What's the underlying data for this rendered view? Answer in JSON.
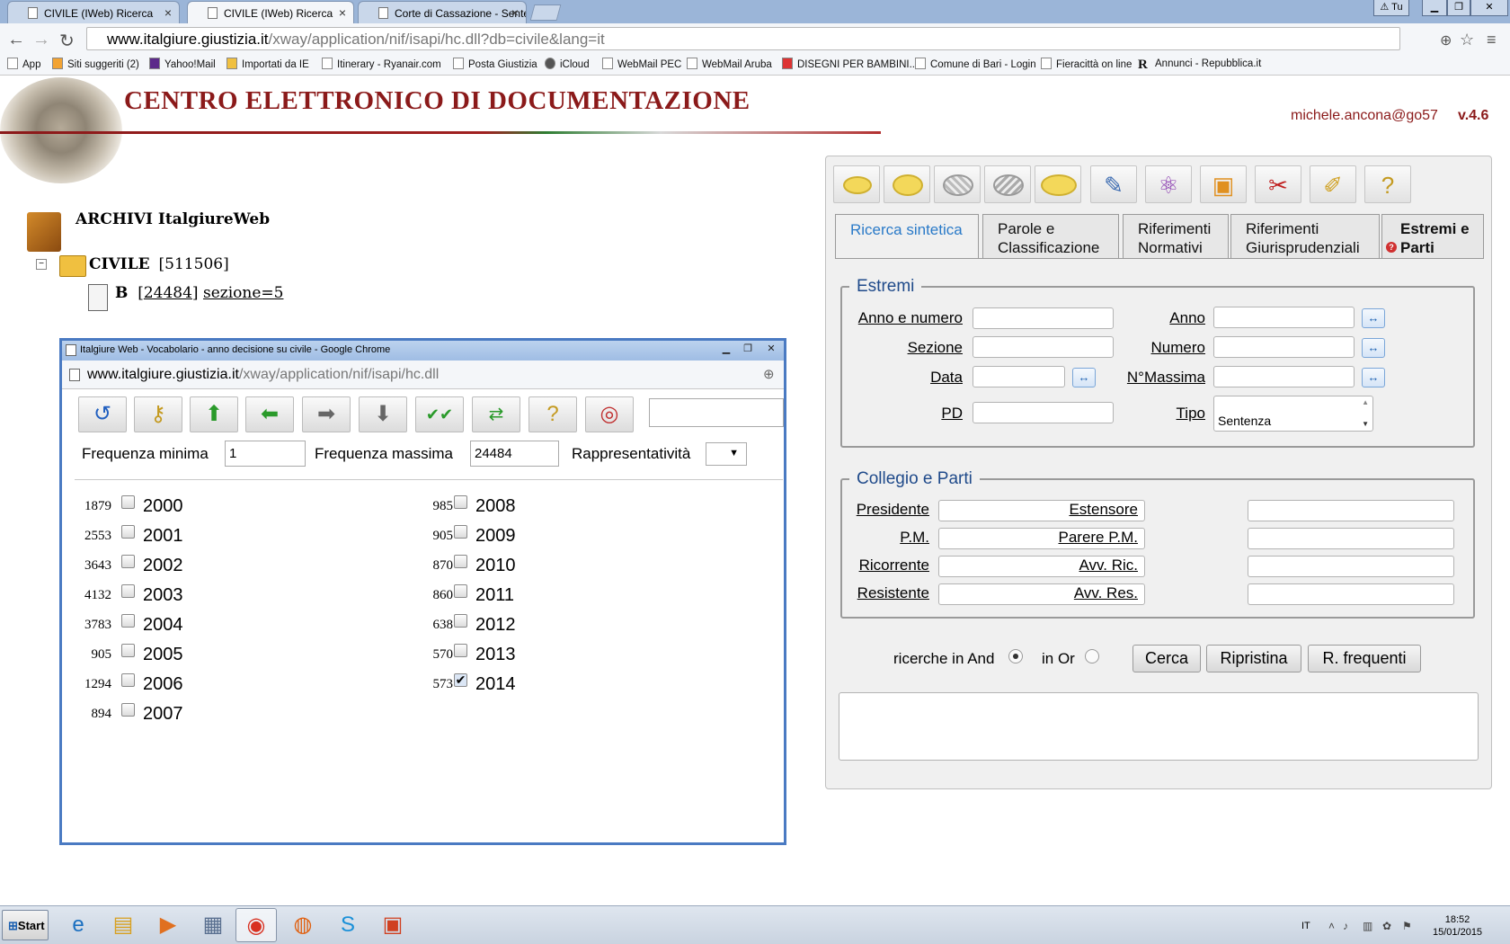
{
  "browser": {
    "tabs": [
      {
        "label": "CIVILE (IWeb) Ricerca",
        "active": false
      },
      {
        "label": "CIVILE (IWeb) Ricerca",
        "active": true
      },
      {
        "label": "Corte di Cassazione - Senter",
        "active": false
      }
    ],
    "url_host": "www.italgiure.giustizia.it",
    "url_path": "/xway/application/nif/isapi/hc.dll?db=civile&lang=it",
    "bookmarks": [
      "App",
      "Siti suggeriti (2)",
      "Yahoo!Mail",
      "Importati da IE",
      "Itinerary - Ryanair.com",
      "Posta Giustizia",
      "iCloud",
      "WebMail PEC",
      "WebMail Aruba",
      "DISEGNI PER BAMBINI...",
      "Comune di Bari - Login",
      "Fieracittà on line",
      "Annunci - Repubblica.it"
    ]
  },
  "header": {
    "title": "CENTRO ELETTRONICO DI DOCUMENTAZIONE",
    "user": "michele.ancona@go57",
    "version": "v.4.6"
  },
  "tree": {
    "root": "ARCHIVI ItalgiureWeb",
    "civile_label": "CIVILE",
    "civile_count": "[511506]",
    "child_label": "B",
    "child_count_open": "[",
    "child_count": "24484",
    "child_count_close": "]",
    "child_filter": "sezione=5"
  },
  "popup": {
    "title": "Italgiure Web - Vocabolario - anno decisione su civile - Google Chrome",
    "url_host": "www.italgiure.giustizia.it",
    "url_path": "/xway/application/nif/isapi/hc.dll",
    "freq_min_label": "Frequenza minima",
    "freq_min_value": "1",
    "freq_max_label": "Frequenza massima",
    "freq_max_value": "24484",
    "rappr_label": "Rappresentatività",
    "toolbar_icons": [
      "undo-icon",
      "key-icon",
      "arrow-up-icon",
      "arrow-left-icon",
      "arrow-right-icon",
      "arrow-down-icon",
      "check-all-icon",
      "swap-icon",
      "help-icon",
      "lifebuoy-icon"
    ],
    "years_left": [
      {
        "count": "1879",
        "year": "2000",
        "checked": false
      },
      {
        "count": "2553",
        "year": "2001",
        "checked": false
      },
      {
        "count": "3643",
        "year": "2002",
        "checked": false
      },
      {
        "count": "4132",
        "year": "2003",
        "checked": false
      },
      {
        "count": "3783",
        "year": "2004",
        "checked": false
      },
      {
        "count": "905",
        "year": "2005",
        "checked": false
      },
      {
        "count": "1294",
        "year": "2006",
        "checked": false
      },
      {
        "count": "894",
        "year": "2007",
        "checked": false
      }
    ],
    "years_right": [
      {
        "count": "985",
        "year": "2008",
        "checked": false
      },
      {
        "count": "905",
        "year": "2009",
        "checked": false
      },
      {
        "count": "870",
        "year": "2010",
        "checked": false
      },
      {
        "count": "860",
        "year": "2011",
        "checked": false
      },
      {
        "count": "638",
        "year": "2012",
        "checked": false
      },
      {
        "count": "570",
        "year": "2013",
        "checked": false
      },
      {
        "count": "573",
        "year": "2014",
        "checked": true
      }
    ]
  },
  "panel": {
    "tabs": [
      {
        "label": "Ricerca sintetica",
        "selected": true
      },
      {
        "label": "Parole e Classificazione",
        "selected": false
      },
      {
        "label": "Riferimenti Normativi",
        "selected": false
      },
      {
        "label": "Riferimenti Giurisprudenziali",
        "selected": false
      },
      {
        "label": "Estremi e Parti",
        "selected": false
      }
    ],
    "estremi": {
      "legend": "Estremi",
      "anno_numero": "Anno e numero",
      "anno": "Anno",
      "sezione": "Sezione",
      "numero": "Numero",
      "data": "Data",
      "massima": "N°Massima",
      "pd": "PD",
      "tipo": "Tipo",
      "tipo_value": "Sentenza"
    },
    "collegio": {
      "legend": "Collegio e Parti",
      "presidente": "Presidente",
      "estensore": "Estensore",
      "pm": "P.M.",
      "parere_pm": "Parere P.M.",
      "ricorrente": "Ricorrente",
      "avv_ric": "Avv. Ric.",
      "resistente": "Resistente",
      "avv_res": "Avv. Res."
    },
    "search": {
      "and_label": "ricerche in And",
      "or_label": "in Or",
      "mode": "and",
      "cerca": "Cerca",
      "ripristina": "Ripristina",
      "frequenti": "R. frequenti"
    }
  },
  "taskbar": {
    "start": "Start",
    "lang": "IT",
    "time": "18:52",
    "date": "15/01/2015"
  }
}
